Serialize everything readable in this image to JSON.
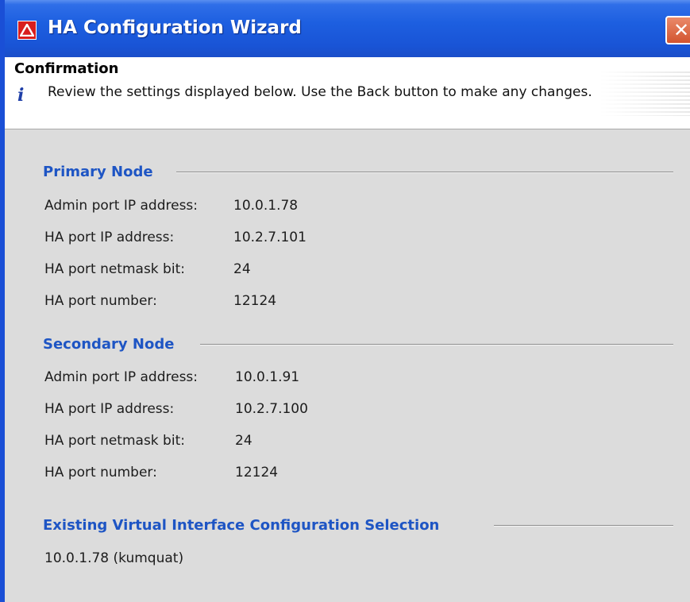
{
  "window": {
    "title": "HA Configuration Wizard",
    "close_label": "✕"
  },
  "header": {
    "title": "Confirmation",
    "description": "Review the settings displayed below.  Use the Back button to make any changes."
  },
  "primary": {
    "title": "Primary Node",
    "rows": [
      {
        "label": "Admin port IP address:",
        "value": "10.0.1.78"
      },
      {
        "label": "HA port IP address:",
        "value": "10.2.7.101"
      },
      {
        "label": "HA port netmask bit:",
        "value": "24"
      },
      {
        "label": "HA port number:",
        "value": "12124"
      }
    ]
  },
  "secondary": {
    "title": "Secondary Node",
    "rows": [
      {
        "label": "Admin port IP address:",
        "value": "10.0.1.91"
      },
      {
        "label": "HA port IP address:",
        "value": "10.2.7.100"
      },
      {
        "label": "HA port netmask bit:",
        "value": "24"
      },
      {
        "label": "HA port number:",
        "value": "12124"
      }
    ]
  },
  "virtual": {
    "title": "Existing Virtual Interface Configuration Selection",
    "value": "10.0.1.78 (kumquat)"
  },
  "colors": {
    "titlebar": "#1d5fe0",
    "section_title": "#1e55c4",
    "body_background": "#dcdcdc",
    "close_button": "#d2542f"
  }
}
